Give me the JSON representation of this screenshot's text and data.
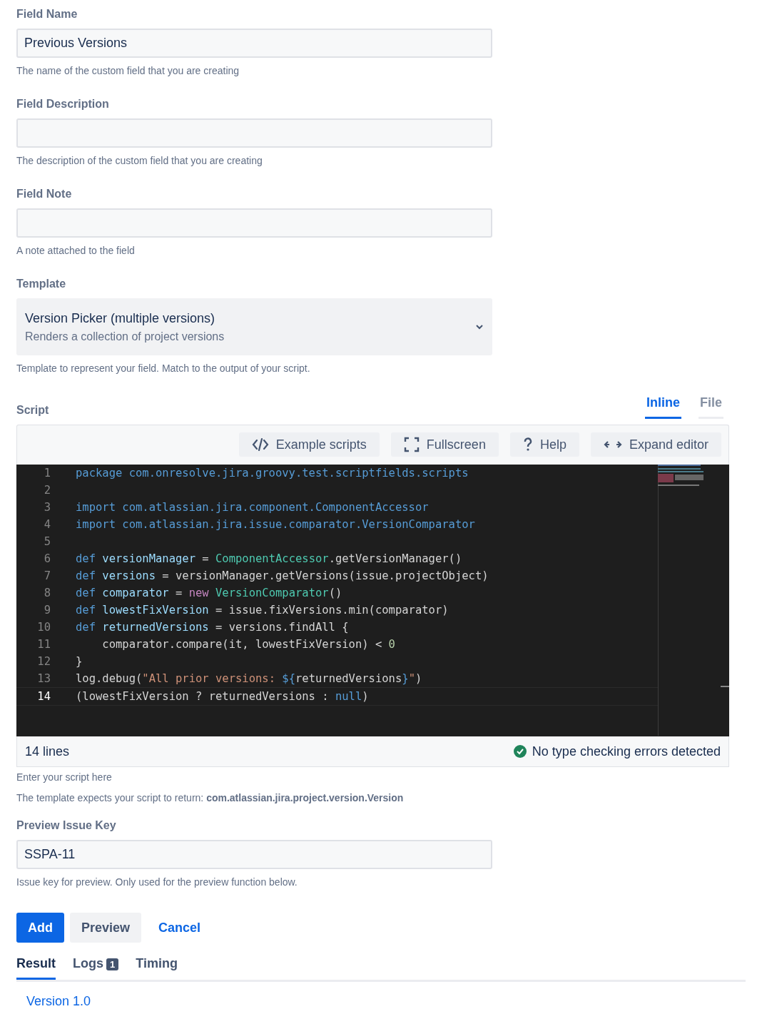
{
  "fields": [
    {
      "label": "Field Name",
      "value": "Previous Versions",
      "help": "The name of the custom field that you are creating"
    },
    {
      "label": "Field Description",
      "help": "The description of the custom field that you are creating"
    },
    {
      "label": "Field Note",
      "help": "A note attached to the field"
    }
  ],
  "template": {
    "label": "Template",
    "title": "Version Picker (multiple versions)",
    "subtitle": "Renders a collection of project versions",
    "help": "Template to represent your field. Match to the output of your script."
  },
  "script": {
    "label": "Script",
    "tabs": [
      {
        "label": "Inline",
        "selected": true
      },
      {
        "label": "File",
        "selected": false
      }
    ],
    "toolbar": [
      {
        "kind": "code",
        "label": "Example scripts"
      },
      {
        "kind": "fullscreen",
        "label": "Fullscreen"
      },
      {
        "kind": "help",
        "label": "Help"
      },
      {
        "kind": "expand",
        "label": "Expand editor"
      }
    ],
    "lines": [
      {
        "number": "1",
        "current": false,
        "tokens": [
          {
            "kind": "kw",
            "text": "package com.onresolve.jira.groovy.test.scriptfields.scripts"
          }
        ]
      },
      {
        "number": "2",
        "current": false
      },
      {
        "number": "3",
        "current": false,
        "tokens": [
          {
            "kind": "kw",
            "text": "import com.atlassian.jira.component.ComponentAccessor"
          }
        ]
      },
      {
        "number": "4",
        "current": false,
        "tokens": [
          {
            "kind": "kw",
            "text": "import com.atlassian.jira.issue.comparator.VersionComparator"
          }
        ]
      },
      {
        "number": "5",
        "current": false
      },
      {
        "number": "6",
        "current": false,
        "tokens": [
          {
            "kind": "kw",
            "text": "def "
          },
          {
            "kind": "var",
            "text": "versionManager"
          },
          {
            "kind": "plain",
            "text": " = "
          },
          {
            "kind": "type",
            "text": "ComponentAccessor"
          },
          {
            "kind": "plain",
            "text": ".getVersionManager()"
          }
        ]
      },
      {
        "number": "7",
        "current": false,
        "tokens": [
          {
            "kind": "kw",
            "text": "def "
          },
          {
            "kind": "var",
            "text": "versions"
          },
          {
            "kind": "plain",
            "text": " = versionManager.getVersions(issue.projectObject)"
          }
        ]
      },
      {
        "number": "8",
        "current": false,
        "tokens": [
          {
            "kind": "kw",
            "text": "def "
          },
          {
            "kind": "var",
            "text": "comparator"
          },
          {
            "kind": "plain",
            "text": " = "
          },
          {
            "kind": "kw2",
            "text": "new "
          },
          {
            "kind": "type",
            "text": "VersionComparator"
          },
          {
            "kind": "plain",
            "text": "()"
          }
        ]
      },
      {
        "number": "9",
        "current": false,
        "tokens": [
          {
            "kind": "kw",
            "text": "def "
          },
          {
            "kind": "var",
            "text": "lowestFixVersion"
          },
          {
            "kind": "plain",
            "text": " = issue.fixVersions.min(comparator)"
          }
        ]
      },
      {
        "number": "10",
        "current": false,
        "tokens": [
          {
            "kind": "kw",
            "text": "def "
          },
          {
            "kind": "var",
            "text": "returnedVersions"
          },
          {
            "kind": "plain",
            "text": " = versions.findAll {"
          }
        ]
      },
      {
        "number": "11",
        "current": false,
        "tokens": [
          {
            "kind": "plain",
            "text": "    comparator.compare(it, lowestFixVersion) < "
          },
          {
            "kind": "num",
            "text": "0"
          }
        ]
      },
      {
        "number": "12",
        "current": false,
        "tokens": [
          {
            "kind": "plain",
            "text": "}"
          }
        ]
      },
      {
        "number": "13",
        "current": false,
        "tokens": [
          {
            "kind": "plain",
            "text": "log.debug("
          },
          {
            "kind": "str",
            "text": "\"All prior versions: "
          },
          {
            "kind": "kw",
            "text": "${"
          },
          {
            "kind": "plain",
            "text": "returnedVersions"
          },
          {
            "kind": "kw",
            "text": "}"
          },
          {
            "kind": "str",
            "text": "\""
          },
          {
            "kind": "plain",
            "text": ")"
          }
        ]
      },
      {
        "number": "14",
        "current": true,
        "tokens": [
          {
            "kind": "plain",
            "text": "(lowestFixVersion ? returnedVersions : "
          },
          {
            "kind": "kw",
            "text": "null"
          },
          {
            "kind": "plain",
            "text": ")"
          }
        ]
      }
    ],
    "line_count": "14 lines",
    "status": "No type checking errors detected",
    "help": "Enter your script here",
    "returns_prefix": "The template expects your script to return: ",
    "returns_type": "com.atlassian.jira.project.version.Version"
  },
  "preview_key": {
    "label": "Preview Issue Key",
    "value": "SSPA-11",
    "help": "Issue key for preview. Only used for the preview function below."
  },
  "buttons": [
    {
      "kind": "primary",
      "label": "Add"
    },
    {
      "kind": "default",
      "label": "Preview"
    },
    {
      "kind": "link",
      "label": "Cancel"
    }
  ],
  "result_tabs": [
    {
      "label": "Result",
      "selected": true
    },
    {
      "label": "Logs",
      "badge": "1",
      "selected": false
    },
    {
      "label": "Timing",
      "selected": false
    }
  ],
  "result": "Version 1.0"
}
